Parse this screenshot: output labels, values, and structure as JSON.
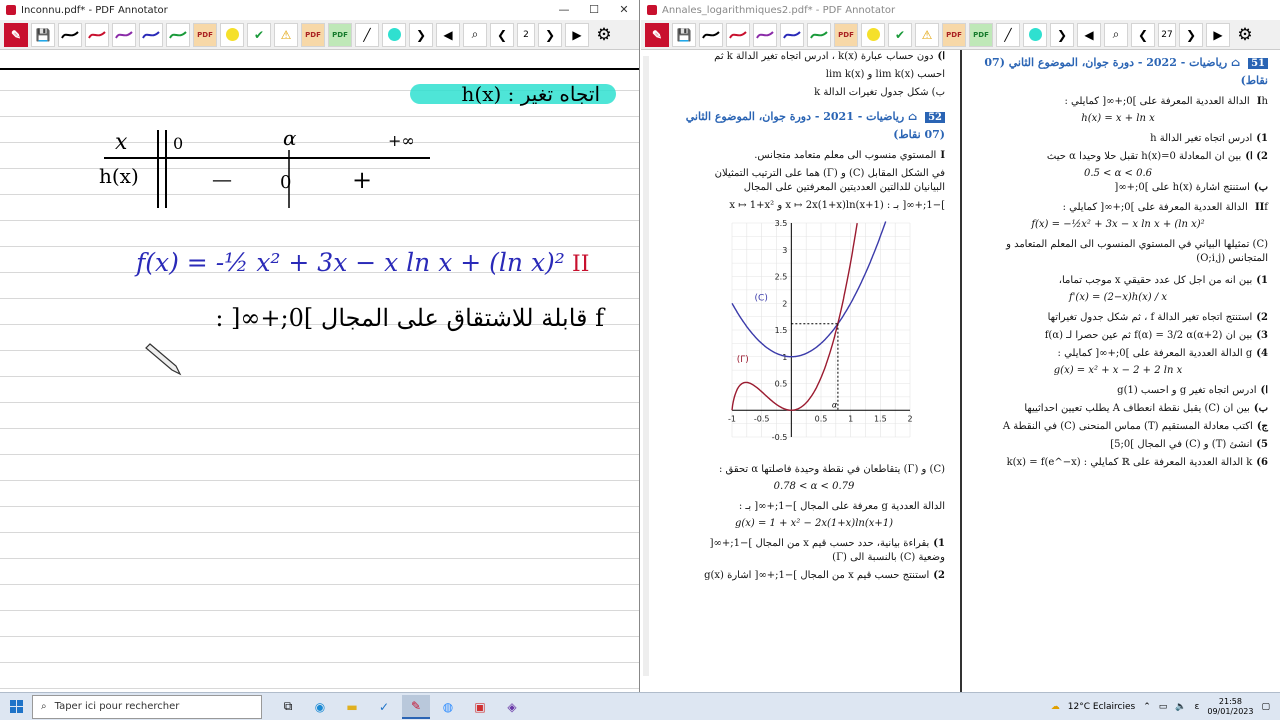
{
  "left_window": {
    "title": "Inconnu.pdf* - PDF Annotator",
    "page_number": "2",
    "handwriting": {
      "heading": "اتجاه تغير : h(x)",
      "table": {
        "var_label": "x",
        "func_label": "h(x)",
        "x0": "0",
        "x1": "α",
        "x2": "+∞",
        "sign_minus": "—",
        "zero": "0",
        "sign_plus": "+"
      },
      "function_line": "f(x) = -½ x² + 3x − x ln x + (ln x)²",
      "roman_II": "II",
      "sentence": "f قابلة للاشتقاق على المجال ]0;+∞[ :"
    }
  },
  "right_window": {
    "title": "Annales_logarithmiques2.pdf* - PDF Annotator",
    "page_number": "27",
    "right_column": {
      "ex51_num": "51",
      "ex51_title": "رياضيات - 2022 - دورة جوان، الموضوع الثاني (07 نقاط)",
      "partI_intro": "h الدالة العددية المعرفة على ]0;+∞[ كمايلي :",
      "h_eq": "h(x) = x + ln x",
      "q1": "ادرس اتجاه تغير الدالة h",
      "q2a": "بين ان المعادلة h(x)=0 تقبل حلا وحيدا α حيث",
      "q2a_range": "0.5 < α < 0.6",
      "q2b": "استنتج اشارة h(x) على ]0;+∞[",
      "partII_intro": "f الدالة العددية المعرفة على ]0;+∞[ كمايلي :",
      "f_eq": "f(x) = −½x² + 3x − x ln x + (ln x)²",
      "curve_text": "(C) تمثيلها البياني في المستوي المنسوب الى المعلم المتعامد و المتجانس (O;i,j)",
      "q1b": "بين انه من اجل كل عدد حقيقي x موجب تماما،",
      "fprime_eq": "f'(x) = (2−x)h(x) / x",
      "q2c": "استنتج اتجاه تغير الدالة f ، ثم شكل جدول تغيراتها",
      "q3": "بين ان f(α) = 3/2 α(α+2) ثم عين حصرا لـ f(α)",
      "q4": "g الدالة العددية المعرفة على ]0;+∞[ كمايلي :",
      "g_eq": "g(x) = x² + x − 2 + 2 ln x",
      "q4a": "ادرس اتجاه تغير g و احسب g(1)",
      "q4b": "بين ان (C) يقبل نقطة انعطاف A يطلب تعيين احداثييها",
      "q4c": "اكتب معادلة المستقيم (T) مماس المنحنى (C) في النقطة A",
      "q5": "انشئ (T) و (C) في المجال ]0;5]",
      "q6": "k الدالة العددية المعرفة على ℝ كمايلي : k(x) = f(e^−x)"
    },
    "left_column": {
      "top1": "دون حساب عبارة k(x) ، ادرس اتجاه تغير الدالة k ثم",
      "top2": "احسب lim k(x) و lim k(x)",
      "top3": "ب) شكل جدول تغيرات الدالة k",
      "ex52_num": "52",
      "ex52_title": "رياضيات - 2021 - دورة جوان، الموضوع الثاني (07 نقاط)",
      "p1": "المستوي منسوب الى معلم متعامد متجانس.",
      "p2": "في الشكل المقابل (C) و (Γ) هما على الترتيب التمثيلان البيانيان للدالتين العدديتين المعرفتين على المجال",
      "p3": "]−1;+∞[ بـ : x ↦ 2x(1+x)ln(x+1) و x ↦ 1+x²",
      "graph": {
        "label_C": "(C)",
        "label_Gamma": "(Γ)",
        "label_alpha": "α"
      },
      "p4": "(C) و (Γ) يتقاطعان في نقطة وحيدة فاصلتها α تحقق :",
      "alpha_range": "0.78 < α < 0.79",
      "p5": "الدالة العددية g معرفة على المجال ]−1;+∞[ بـ :",
      "g_eq": "g(x) = 1 + x² − 2x(1+x)ln(x+1)",
      "p6": "بقراءة بيانية، حدد حسب قيم x من المجال ]−1;+∞[ وضعية (C) بالنسبة الى (Γ)",
      "p7": "استنتج حسب قيم x من المجال ]−1;+∞[ اشارة g(x)"
    }
  },
  "chart_data": {
    "type": "line",
    "title": "",
    "xlim": [
      -1,
      2
    ],
    "ylim": [
      -0.5,
      3.5
    ],
    "x_ticks": [
      "-1",
      "-0.5",
      "0.5",
      "1",
      "1.5",
      "2"
    ],
    "y_ticks": [
      "-0.5",
      "0.5",
      "1",
      "1.5",
      "2",
      "2.5",
      "3",
      "3.5"
    ],
    "series": [
      {
        "name": "(C)",
        "color": "#3b3baa",
        "function": "1+x^2"
      },
      {
        "name": "(Γ)",
        "color": "#9b1b30",
        "function": "2x(1+x)ln(x+1)"
      }
    ],
    "intersection": {
      "x": 0.785,
      "y": 1.616,
      "label": "α"
    },
    "grid": true
  },
  "taskbar": {
    "search_placeholder": "Taper ici pour rechercher",
    "weather": "12°C  Eclaircies",
    "lang": "ε",
    "time": "21:58",
    "date": "09/01/2023"
  },
  "colors": {
    "brand_red": "#c8102e",
    "doc_blue": "#2a64b4",
    "ink_blue": "#2a2ab8",
    "highlight": "#2fe0d0"
  }
}
